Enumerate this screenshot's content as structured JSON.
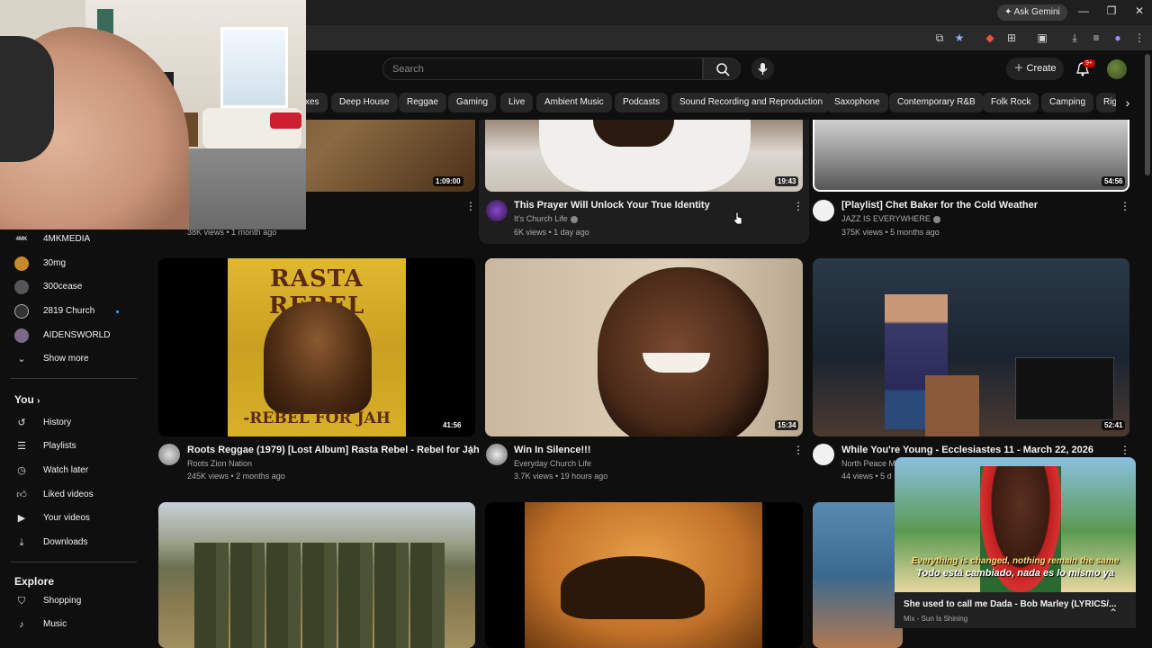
{
  "browser": {
    "gemini_label": "Ask Gemini",
    "window_controls": {
      "minimize": "—",
      "restore": "❐",
      "close": "✕"
    }
  },
  "header": {
    "search_placeholder": "Search",
    "create_label": "Create",
    "notif_count": "9+"
  },
  "chips": [
    {
      "label": "xes"
    },
    {
      "label": "Deep House"
    },
    {
      "label": "Reggae"
    },
    {
      "label": "Gaming"
    },
    {
      "label": "Live"
    },
    {
      "label": "Ambient Music"
    },
    {
      "label": "Podcasts"
    },
    {
      "label": "Sound Recording and Reproduction"
    },
    {
      "label": "Saxophone"
    },
    {
      "label": "Contemporary R&B"
    },
    {
      "label": "Folk Rock"
    },
    {
      "label": "Camping"
    },
    {
      "label": "Righ"
    }
  ],
  "sidebar": {
    "subscriptions": [
      {
        "label": "4MKMEDIA",
        "icon_text": "4MK"
      },
      {
        "label": "30mg",
        "icon_text": ""
      },
      {
        "label": "300cease",
        "icon_text": ""
      },
      {
        "label": "2819 Church",
        "icon_text": ""
      },
      {
        "label": "AIDENSWORLD",
        "icon_text": ""
      }
    ],
    "show_more": "Show more",
    "you_heading": "You",
    "you_items": [
      {
        "label": "History",
        "icon": "history-icon"
      },
      {
        "label": "Playlists",
        "icon": "playlists-icon"
      },
      {
        "label": "Watch later",
        "icon": "watch-later-icon"
      },
      {
        "label": "Liked videos",
        "icon": "like-icon"
      },
      {
        "label": "Your videos",
        "icon": "your-videos-icon"
      },
      {
        "label": "Downloads",
        "icon": "download-icon"
      }
    ],
    "explore_heading": "Explore",
    "explore_items": [
      {
        "label": "Shopping",
        "icon": "shopping-icon"
      },
      {
        "label": "Music",
        "icon": "music-icon"
      }
    ]
  },
  "videos": {
    "row1": [
      {
        "duration": "1:09:00",
        "meta": "38K views • 1 month ago"
      },
      {
        "duration": "19:43",
        "title": "This Prayer Will Unlock Your True Identity",
        "channel": "It's Church Life",
        "meta": "6K views • 1 day ago"
      },
      {
        "duration": "54:56",
        "title": "[Playlist] Chet Baker for the Cold Weather",
        "channel": "JAZZ IS EVERYWHERE",
        "meta": "375K views • 5 months ago"
      }
    ],
    "row2": [
      {
        "thumb_text_top": "RASTA REBEL",
        "thumb_text_bottom": "-REBEL FOR JAH",
        "duration": "41:56",
        "title": "Roots Reggae (1979) [Lost Album] Rasta Rebel - Rebel for Jah",
        "channel": "Roots Zion Nation",
        "meta": "245K views • 2 months ago"
      },
      {
        "duration": "15:34",
        "title": "Win In Silence!!!",
        "channel": "Everyday Church Life",
        "meta": "3.7K views • 19 hours ago"
      },
      {
        "duration": "52:41",
        "title": "While You're Young - Ecclesiastes 11 - March 22, 2026",
        "channel": "North Peace M",
        "meta": "44 views • 5 d"
      }
    ]
  },
  "miniplayer": {
    "lyric_en": "Everything is changed, nothing remain the same",
    "lyric_es": "Todo está cambiado, nada es lo mismo ya",
    "title": "She used to call me Dada - Bob Marley (LYRICS/...",
    "subtitle": "Mix - Sun Is Shining"
  },
  "colors": {
    "background": "#0f0f0f",
    "chip": "#272727",
    "text_secondary": "#aaaaaa",
    "notif_badge": "#cc0000"
  }
}
